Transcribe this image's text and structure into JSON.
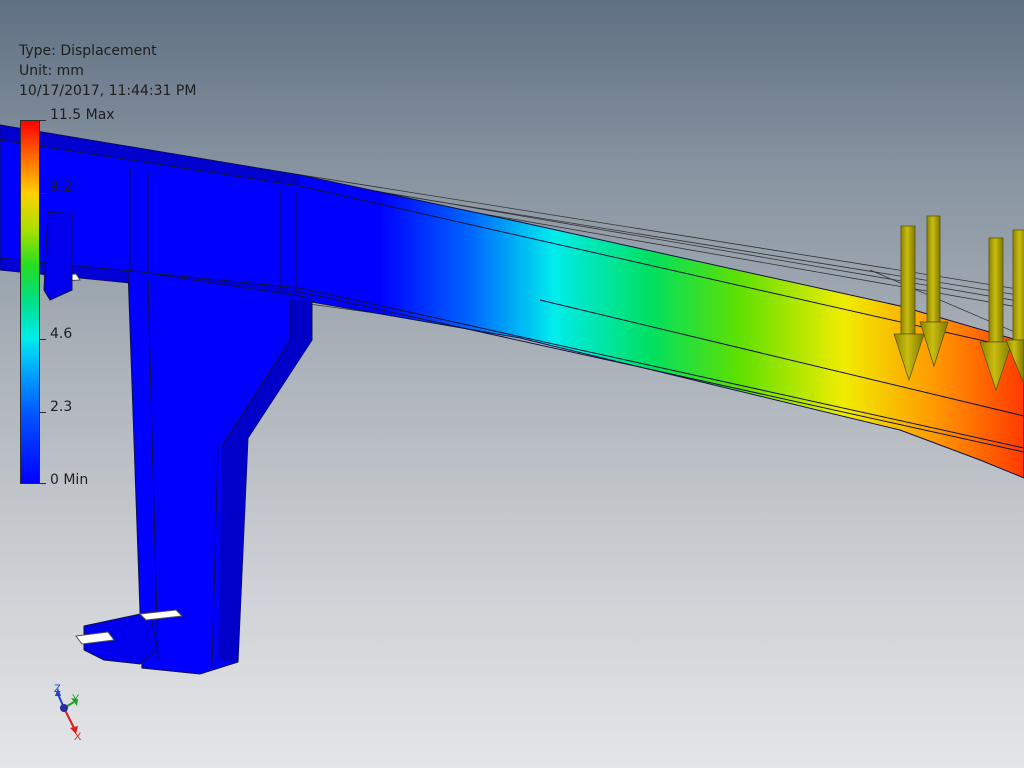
{
  "result": {
    "type_text": "Type: Displacement",
    "unit_text": "Unit: mm",
    "timestamp": "10/17/2017, 11:44:31 PM"
  },
  "legend": {
    "labels": [
      {
        "text": "11.5 Max",
        "value": 11.5
      },
      {
        "text": "9.2",
        "value": 9.2
      },
      {
        "text": "4.6",
        "value": 4.6
      },
      {
        "text": "2.3",
        "value": 2.3
      },
      {
        "text": "0 Min",
        "value": 0
      }
    ],
    "colors": [
      "#ff0000",
      "#ff6a00",
      "#ffd000",
      "#aadf00",
      "#22dd22",
      "#00e08a",
      "#00ecec",
      "#00a0ff",
      "#0050ff",
      "#0000ff"
    ]
  },
  "view_cube": {
    "axis_x": "X",
    "axis_y": "Y",
    "axis_z": "Z",
    "x_color": "#d42020",
    "y_color": "#20a020",
    "z_color": "#2040d0"
  }
}
